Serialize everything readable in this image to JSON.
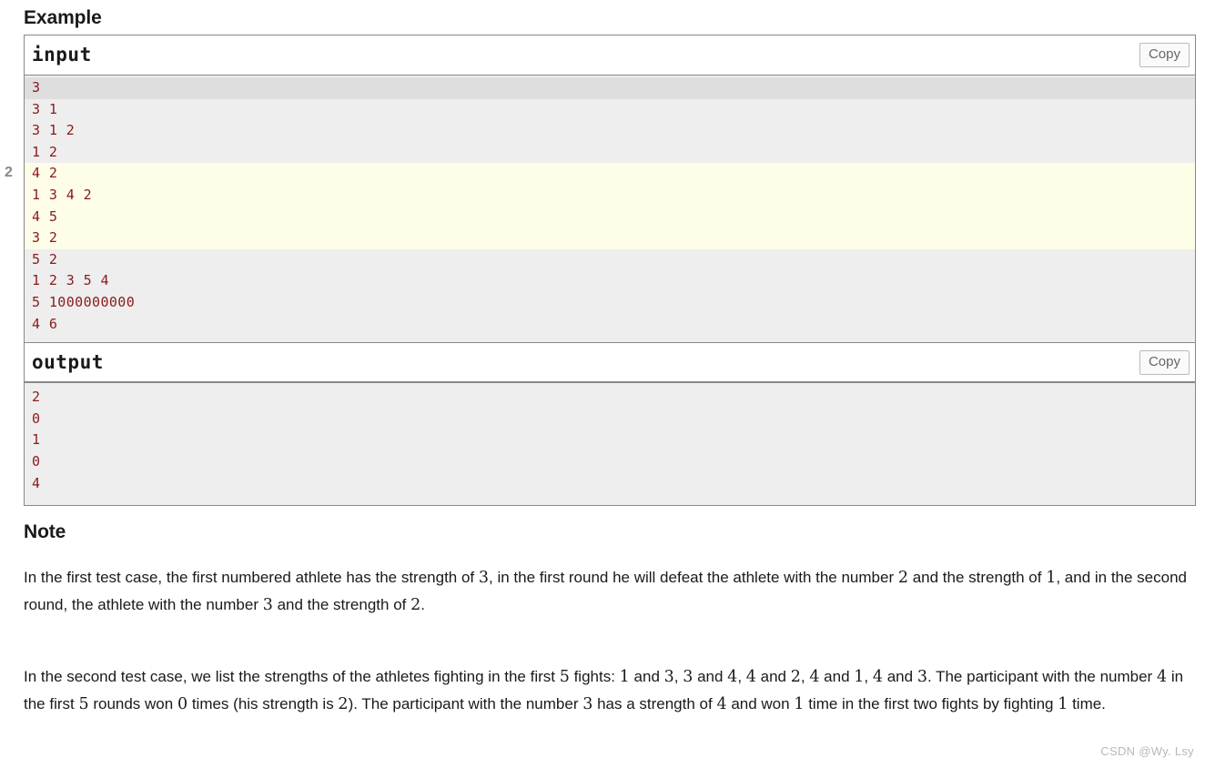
{
  "example": {
    "heading": "Example",
    "input": {
      "title": "input",
      "copy_label": "Copy",
      "lines": [
        "3",
        "3 1",
        "3 1 2",
        "1 2",
        "4 2",
        "1 3 4 2",
        "4 5",
        "3 2",
        "5 2",
        "1 2 3 5 4",
        "5 1000000000",
        "4 6"
      ],
      "first_line_shaded_index": 0,
      "highlighted_line_indices": [
        4,
        5,
        6,
        7
      ],
      "gutter_markers": [
        {
          "label": "2",
          "line_index": 4
        }
      ]
    },
    "output": {
      "title": "output",
      "copy_label": "Copy",
      "lines": [
        "2",
        "0",
        "1",
        "0",
        "4"
      ]
    }
  },
  "note": {
    "heading": "Note",
    "paragraphs": [
      {
        "id": "note-p1",
        "parts": [
          {
            "t": "text",
            "v": "In the first test case, the first numbered athlete has the strength of "
          },
          {
            "t": "num",
            "v": "3"
          },
          {
            "t": "text",
            "v": ", in the first round he will defeat the athlete with the number "
          },
          {
            "t": "num",
            "v": "2"
          },
          {
            "t": "text",
            "v": " and the strength of "
          },
          {
            "t": "num",
            "v": "1"
          },
          {
            "t": "text",
            "v": ", and in the second round, the athlete with the number "
          },
          {
            "t": "num",
            "v": "3"
          },
          {
            "t": "text",
            "v": " and the strength of "
          },
          {
            "t": "num",
            "v": "2"
          },
          {
            "t": "text",
            "v": "."
          }
        ]
      },
      {
        "id": "note-p2",
        "parts": [
          {
            "t": "text",
            "v": "In the second test case, we list the strengths of the athletes fighting in the first "
          },
          {
            "t": "num",
            "v": "5"
          },
          {
            "t": "text",
            "v": " fights: "
          },
          {
            "t": "num",
            "v": "1"
          },
          {
            "t": "text",
            "v": " and "
          },
          {
            "t": "num",
            "v": "3"
          },
          {
            "t": "text",
            "v": ", "
          },
          {
            "t": "num",
            "v": "3"
          },
          {
            "t": "text",
            "v": " and "
          },
          {
            "t": "num",
            "v": "4"
          },
          {
            "t": "text",
            "v": ", "
          },
          {
            "t": "num",
            "v": "4"
          },
          {
            "t": "text",
            "v": " and "
          },
          {
            "t": "num",
            "v": "2"
          },
          {
            "t": "text",
            "v": ", "
          },
          {
            "t": "num",
            "v": "4"
          },
          {
            "t": "text",
            "v": " and "
          },
          {
            "t": "num",
            "v": "1"
          },
          {
            "t": "text",
            "v": ", "
          },
          {
            "t": "num",
            "v": "4"
          },
          {
            "t": "text",
            "v": " and "
          },
          {
            "t": "num",
            "v": "3"
          },
          {
            "t": "text",
            "v": ". The participant with the number "
          },
          {
            "t": "num",
            "v": "4"
          },
          {
            "t": "text",
            "v": " in the first "
          },
          {
            "t": "num",
            "v": "5"
          },
          {
            "t": "text",
            "v": " rounds won "
          },
          {
            "t": "num",
            "v": "0"
          },
          {
            "t": "text",
            "v": " times (his strength is "
          },
          {
            "t": "num",
            "v": "2"
          },
          {
            "t": "text",
            "v": "). The participant with the number "
          },
          {
            "t": "num",
            "v": "3"
          },
          {
            "t": "text",
            "v": " has a strength of "
          },
          {
            "t": "num",
            "v": "4"
          },
          {
            "t": "text",
            "v": " and won "
          },
          {
            "t": "num",
            "v": "1"
          },
          {
            "t": "text",
            "v": " time in the first two fights by fighting "
          },
          {
            "t": "num",
            "v": "1"
          },
          {
            "t": "text",
            "v": " time."
          }
        ]
      }
    ]
  },
  "watermark": {
    "text": "CSDN @Wy. Lsy"
  },
  "colors": {
    "code_text": "#8b1a1a",
    "code_bg": "#eeeeee",
    "code_bg_first": "#dedede",
    "code_bg_highlight": "#fdfde8",
    "border": "#888888",
    "watermark": "#b8b8b8"
  }
}
